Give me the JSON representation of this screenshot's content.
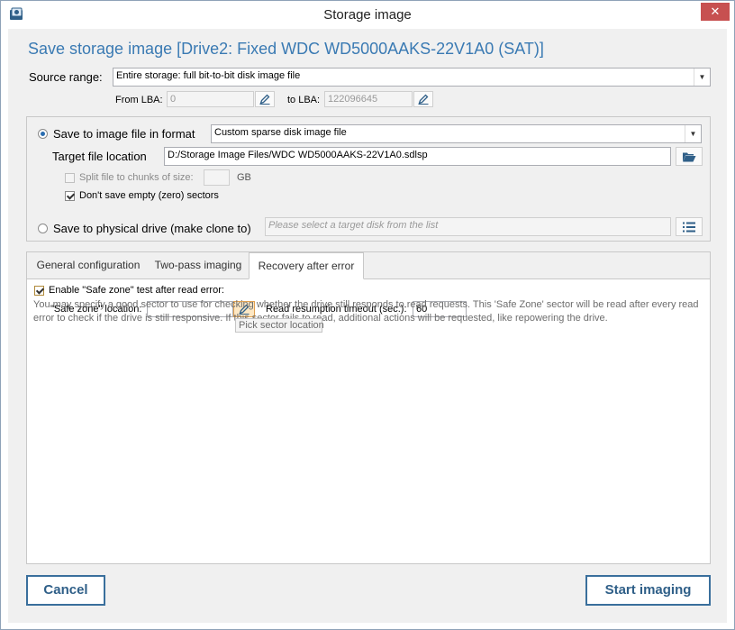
{
  "window": {
    "title": "Storage image",
    "close_glyph": "✕"
  },
  "heading": "Save storage image [Drive2: Fixed WDC WD5000AAKS-22V1A0 (SAT)]",
  "source": {
    "label": "Source range:",
    "value": "Entire storage: full bit-to-bit disk image file",
    "from_label": "From LBA:",
    "from_value": "0",
    "to_label": "to LBA:",
    "to_value": "122096645"
  },
  "image_file": {
    "radio_label": "Save to image file in format",
    "format_value": "Custom sparse disk image file",
    "target_label": "Target file location",
    "target_value": "D:/Storage Image Files/WDC WD5000AAKS-22V1A0.sdlsp",
    "split_label": "Split file to chunks of size:",
    "split_value": "",
    "split_unit": "GB",
    "empty_label": "Don't save empty (zero) sectors"
  },
  "physical": {
    "radio_label": "Save to physical drive (make clone to)",
    "placeholder": "Please select a target disk from the list"
  },
  "tabs": [
    "General configuration",
    "Two-pass imaging",
    "Recovery after error"
  ],
  "recovery": {
    "enable_label": "Enable \"Safe zone\" test after read error:",
    "location_label": "\"Safe zone\" location:",
    "location_value": "",
    "timeout_label": "Read resumption timeout (sec.):",
    "timeout_value": "60",
    "tooltip": "Pick sector location",
    "description": "You may specify a good sector to use for checking whether the drive still responds to read requests. This 'Safe Zone' sector will be read after every read error to check if the drive is still responsive. If this sector fails to read, additional actions will be requested, like repowering the drive."
  },
  "buttons": {
    "cancel": "Cancel",
    "start": "Start imaging"
  },
  "icons": {
    "app": "app-icon",
    "pencil": "pencil-icon",
    "folder": "folder-open-icon",
    "list": "list-icon",
    "dropdown": "chevron-down-icon"
  },
  "colors": {
    "accent": "#3a7ab3",
    "close": "#c75050",
    "button_border": "#3a6f9c"
  }
}
